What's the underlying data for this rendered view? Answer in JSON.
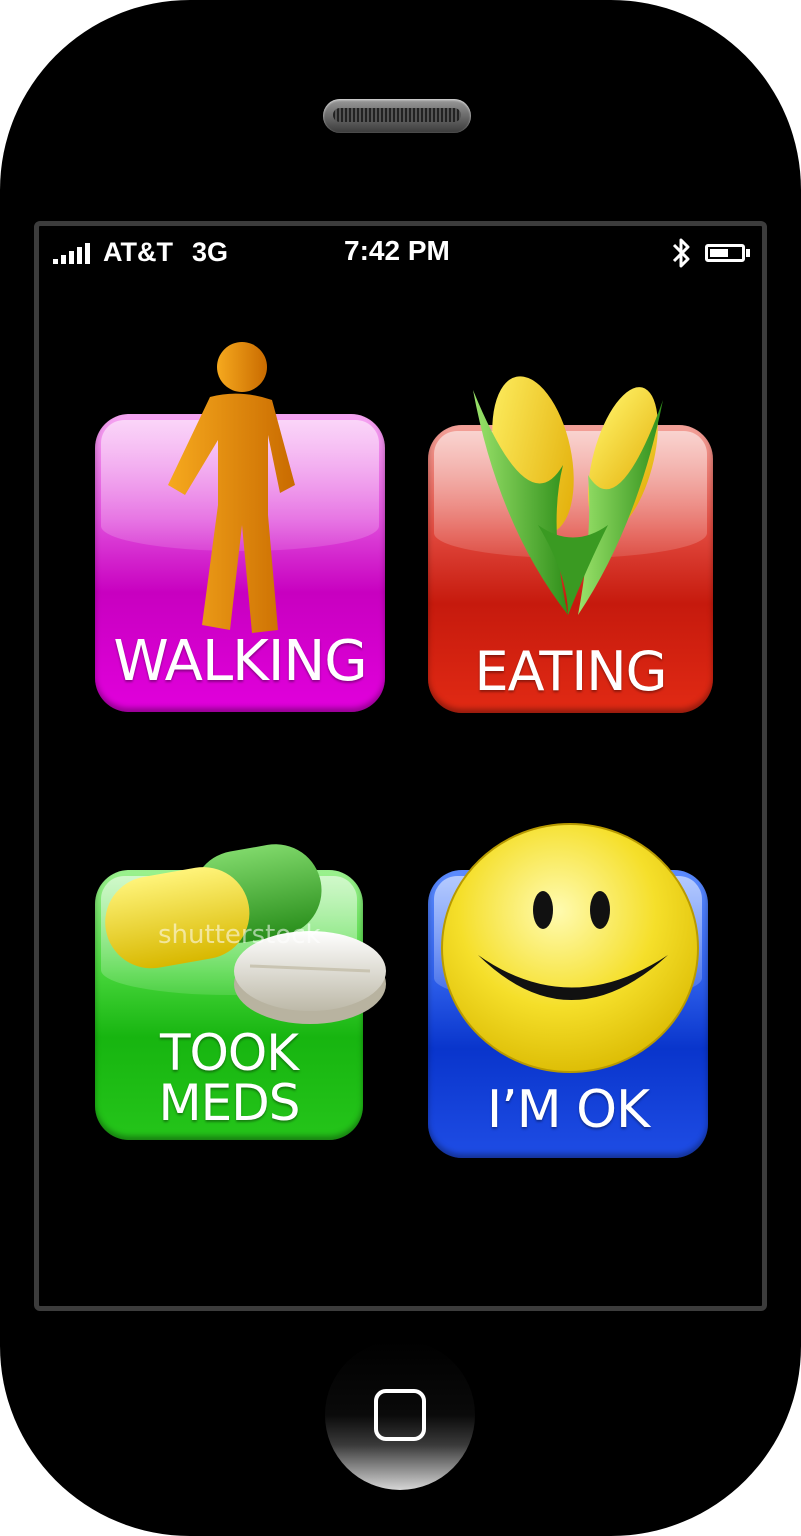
{
  "status_bar": {
    "carrier": "AT&T",
    "network": "3G",
    "time": "7:42 PM",
    "signal_bars": 5,
    "icons": [
      "signal-bars-icon",
      "bluetooth-icon",
      "battery-icon"
    ]
  },
  "apps": [
    {
      "id": "walking",
      "label": "WALKING",
      "icon": "walking-person-icon",
      "color": "#c800c0"
    },
    {
      "id": "eating",
      "label": "EATING",
      "icon": "corn-icon",
      "color": "#c61a0d"
    },
    {
      "id": "meds",
      "label_lines": [
        "TOOK",
        "MEDS"
      ],
      "icon": "pills-icon",
      "color": "#17b510"
    },
    {
      "id": "ok",
      "label": "I’M OK",
      "icon": "smiley-face-icon",
      "color": "#0935cc"
    }
  ],
  "watermark": "shutterstock",
  "hardware": {
    "home_button_icon": "home-square-icon",
    "speaker": "earpiece-speaker"
  }
}
